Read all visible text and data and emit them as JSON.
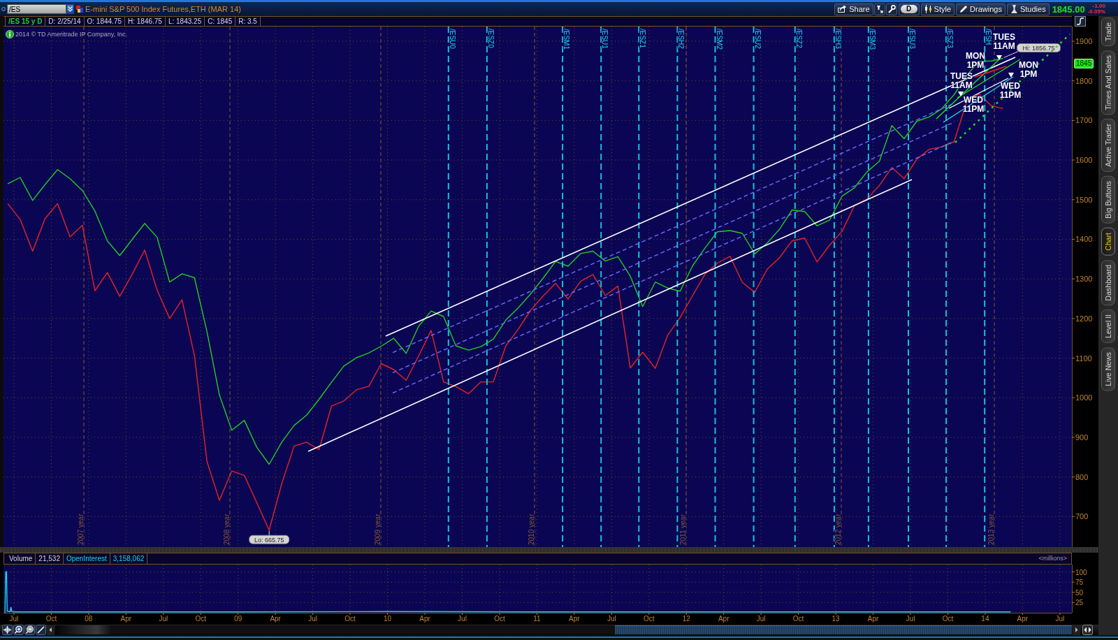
{
  "toolbar": {
    "symbol": "/ES",
    "title": "E-mini S&P 500 Index Futures,ETH (MAR 14)",
    "share": "Share",
    "period": "D",
    "style": "Style",
    "drawings": "Drawings",
    "studies": "Studies"
  },
  "quote": {
    "last": "1845.00",
    "change": "-1.00",
    "change_percent": "-0.05%"
  },
  "info_row": [
    {
      "kind": "symbol",
      "text": "/ES 15 y D"
    },
    {
      "kind": "value",
      "text": "D: 2/25/14"
    },
    {
      "kind": "value",
      "text": "O: 1844.75"
    },
    {
      "kind": "value",
      "text": "H: 1846.75"
    },
    {
      "kind": "value",
      "text": "L: 1843.25"
    },
    {
      "kind": "value",
      "text": "C: 1845"
    },
    {
      "kind": "value",
      "text": "R: 3.5"
    }
  ],
  "price_chart": {
    "copyright": "2014 © TD Ameritrade IP Company, Inc.",
    "last_price_tag": "1845",
    "year_labels": [
      "2007 year",
      "2008 year",
      "2009 year",
      "2010 year",
      "2011 year",
      "2012 year",
      "2013 year"
    ],
    "contract_labels": [
      "/ESU0",
      "/ESZ0",
      "/ESM1",
      "/ESU1",
      "/ESZ1",
      "/ESH2",
      "/ESM2",
      "/ESU2",
      "/ESZ2",
      "/ESH3",
      "/ESM3",
      "/ESU3",
      "/ESZ3",
      "/ESH"
    ],
    "chart_data": {
      "type": "line",
      "grid": true,
      "xlim": [
        2007.43,
        2014.758
      ],
      "ylim": [
        623,
        1937
      ],
      "yticks": [
        700,
        800,
        900,
        1000,
        1100,
        1200,
        1300,
        1400,
        1500,
        1600,
        1700,
        1800,
        1900
      ],
      "x": [
        2007.458,
        2007.542,
        2007.625,
        2007.708,
        2007.792,
        2007.875,
        2007.958,
        2008.042,
        2008.125,
        2008.208,
        2008.292,
        2008.375,
        2008.458,
        2008.542,
        2008.625,
        2008.708,
        2008.792,
        2008.875,
        2008.958,
        2009.042,
        2009.125,
        2009.208,
        2009.292,
        2009.375,
        2009.458,
        2009.542,
        2009.625,
        2009.708,
        2009.792,
        2009.875,
        2009.958,
        2010.042,
        2010.125,
        2010.208,
        2010.292,
        2010.375,
        2010.458,
        2010.542,
        2010.625,
        2010.708,
        2010.792,
        2010.875,
        2010.958,
        2011.042,
        2011.125,
        2011.208,
        2011.292,
        2011.375,
        2011.458,
        2011.542,
        2011.625,
        2011.708,
        2011.792,
        2011.875,
        2011.958,
        2012.042,
        2012.125,
        2012.208,
        2012.292,
        2012.375,
        2012.458,
        2012.542,
        2012.625,
        2012.708,
        2012.792,
        2012.875,
        2012.958,
        2013.042,
        2013.125,
        2013.208,
        2013.292,
        2013.375,
        2013.458,
        2013.542,
        2013.625,
        2013.708,
        2013.792,
        2013.875,
        2013.958,
        2014.042,
        2014.12
      ],
      "series": [
        {
          "color": "#22cc22",
          "values": [
            1540,
            1556,
            1498,
            1538,
            1576,
            1553,
            1523,
            1471,
            1396,
            1359,
            1400,
            1440,
            1405,
            1292,
            1313,
            1303,
            1167,
            1007,
            918,
            943,
            875,
            832,
            888,
            930,
            956,
            996,
            1039,
            1080,
            1101,
            1113,
            1130,
            1150,
            1112,
            1180,
            1219,
            1205,
            1131,
            1120,
            1129,
            1148,
            1196,
            1227,
            1262,
            1302,
            1344,
            1332,
            1364,
            1370,
            1345,
            1356,
            1307,
            1230,
            1292,
            1277,
            1269,
            1333,
            1378,
            1419,
            1422,
            1415,
            1363,
            1391,
            1426,
            1474,
            1470,
            1434,
            1448,
            1509,
            1530,
            1570,
            1597,
            1687,
            1654,
            1698,
            1709,
            1729,
            1765,
            1813,
            1849,
            1850,
            1856.75
          ]
        },
        {
          "color": "#e82222",
          "values": [
            1490,
            1450,
            1370,
            1452,
            1490,
            1406,
            1435,
            1270,
            1316,
            1256,
            1312,
            1373,
            1272,
            1200,
            1247,
            1106,
            839,
            741,
            815,
            804,
            735,
            665.75,
            783,
            878,
            888,
            869,
            979,
            992,
            1020,
            1029,
            1086,
            1071,
            1044,
            1105,
            1170,
            1040,
            1028,
            1010,
            1040,
            1040,
            1131,
            1173,
            1221,
            1257,
            1289,
            1249,
            1294,
            1311,
            1258,
            1282,
            1075,
            1115,
            1074,
            1158,
            1202,
            1258,
            1312,
            1340,
            1357,
            1291,
            1266,
            1325,
            1354,
            1396,
            1403,
            1343,
            1385,
            1420,
            1485,
            1501,
            1536,
            1581,
            1553,
            1602,
            1627,
            1633,
            1646,
            1746,
            1767,
            1737,
            1730
          ]
        }
      ],
      "annotations": [
        {
          "text": "Hi: 1856.75",
          "x": 2014.12,
          "y": 1856.75
        },
        {
          "text": "Lo: 665.75",
          "x": 2009.208,
          "y": 665.75
        },
        "TUES 11AM",
        "MON 1PM",
        "TUES 11AM",
        "WED 11PM",
        "MON 1PM",
        "WED 11PM"
      ]
    }
  },
  "volume": {
    "legend": [
      {
        "kind": "volume",
        "label": "Volume",
        "value": "21,532"
      },
      {
        "kind": "open_interest",
        "label": "OpenInterest",
        "value": "3,158,062"
      }
    ],
    "chart_data": {
      "type": "line",
      "grid": true,
      "ylabel": "<millions>",
      "xlim": [
        2007.43,
        2014.758
      ],
      "ylim": [
        0,
        118
      ],
      "yticks": [
        25,
        50,
        75,
        100
      ],
      "xticks": [
        {
          "value": 2007.5,
          "label": "Jul"
        },
        {
          "value": 2007.75,
          "label": "Oct"
        },
        {
          "value": 2008.0,
          "label": "08"
        },
        {
          "value": 2008.25,
          "label": "Apr"
        },
        {
          "value": 2008.5,
          "label": "Jul"
        },
        {
          "value": 2008.75,
          "label": "Oct"
        },
        {
          "value": 2009.0,
          "label": "09"
        },
        {
          "value": 2009.25,
          "label": "Apr"
        },
        {
          "value": 2009.5,
          "label": "Jul"
        },
        {
          "value": 2009.75,
          "label": "Oct"
        },
        {
          "value": 2010.0,
          "label": "10"
        },
        {
          "value": 2010.25,
          "label": "Apr"
        },
        {
          "value": 2010.5,
          "label": "Jul"
        },
        {
          "value": 2010.75,
          "label": "Oct"
        },
        {
          "value": 2011.0,
          "label": "11"
        },
        {
          "value": 2011.25,
          "label": "Apr"
        },
        {
          "value": 2011.5,
          "label": "Jul"
        },
        {
          "value": 2011.75,
          "label": "Oct"
        },
        {
          "value": 2012.0,
          "label": "12"
        },
        {
          "value": 2012.25,
          "label": "Apr"
        },
        {
          "value": 2012.5,
          "label": "Jul"
        },
        {
          "value": 2012.75,
          "label": "Oct"
        },
        {
          "value": 2013.0,
          "label": "13"
        },
        {
          "value": 2013.25,
          "label": "Apr"
        },
        {
          "value": 2013.5,
          "label": "Jul"
        },
        {
          "value": 2013.75,
          "label": "Oct"
        },
        {
          "value": 2014.0,
          "label": "14"
        },
        {
          "value": 2014.25,
          "label": "Apr"
        },
        {
          "value": 2014.5,
          "label": "Jul"
        }
      ],
      "x": [
        2007.44,
        2007.445,
        2007.45,
        2007.455,
        2007.46,
        2007.475,
        2007.48,
        2007.485,
        2007.5,
        2007.6,
        2008.0,
        2009.0,
        2010.0,
        2011.0,
        2012.0,
        2013.0,
        2014.0,
        2014.17
      ],
      "series": [
        {
          "color": "#19d8e6",
          "values": [
            0,
            100,
            100,
            4,
            3,
            3,
            14,
            3,
            2,
            2,
            2,
            2,
            3,
            2,
            2,
            2,
            2,
            2
          ]
        }
      ]
    }
  },
  "side_tabs": [
    {
      "label": "Trade",
      "selected": false
    },
    {
      "label": "Times And Sales",
      "selected": false
    },
    {
      "label": "Active Trader",
      "selected": false
    },
    {
      "label": "Big Buttons",
      "selected": false
    },
    {
      "label": "Chart",
      "selected": true
    },
    {
      "label": "Dashboard",
      "selected": false
    },
    {
      "label": "Level II",
      "selected": false
    },
    {
      "label": "Live News",
      "selected": false
    }
  ]
}
